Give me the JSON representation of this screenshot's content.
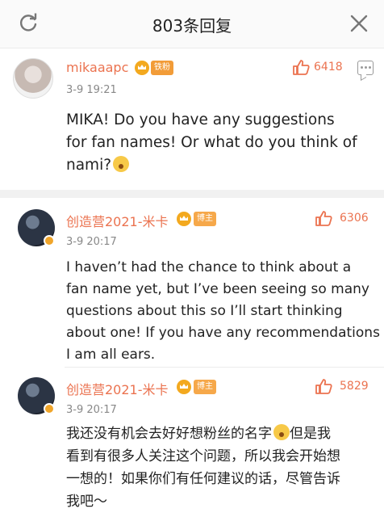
{
  "header": {
    "title": "803条回复"
  },
  "post": {
    "username": "mikaaapc",
    "tag": "铁粉",
    "time": "3-9 19:21",
    "likes": "6418",
    "content_lines": [
      "MIKA!  Do you have any suggestions",
      "for fan names! Or what do you think of",
      "nami?"
    ]
  },
  "replies": [
    {
      "username": "创造营2021-米卡",
      "tag": "博主",
      "time": "3-9 20:17",
      "likes": "6306",
      "content_lines": [
        "I haven’t had the chance to think about a",
        "fan name yet, but I’ve been seeing so many",
        "questions about this so I’ll start thinking",
        "about one! If you have any recommendations",
        "I am all ears."
      ]
    },
    {
      "username": "创造营2021-米卡",
      "tag": "博主",
      "time": "3-9 20:17",
      "likes": "5829",
      "content_lines": [
        "我还没有机会去好好想粉丝的名字",
        "但是我",
        "看到有很多人关注这个问题，所以我会开始想",
        "一想的！如果你们有任何建议的话，尽管告诉",
        "我吧～"
      ]
    }
  ],
  "icons": {
    "refresh": "refresh-icon",
    "close": "close-icon",
    "thumb": "thumbs-up-icon",
    "message": "message-icon",
    "crown": "crown-icon",
    "emoji_surprised": "surprised-emoji-icon",
    "emoji_laugh": "laughing-emoji-icon"
  },
  "colors": {
    "accent": "#eb7350",
    "fan_tag": "#f29c38",
    "host_tag": "#f6a84a",
    "crown": "#f3a91f"
  }
}
